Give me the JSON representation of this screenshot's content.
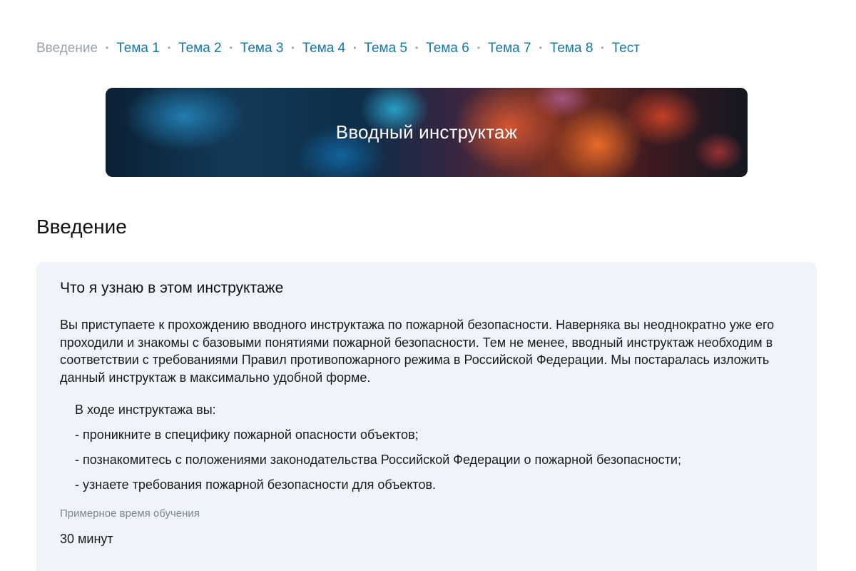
{
  "breadcrumbs": {
    "items": [
      {
        "label": "Введение",
        "current": true
      },
      {
        "label": "Тема 1",
        "current": false
      },
      {
        "label": "Тема 2",
        "current": false
      },
      {
        "label": "Тема 3",
        "current": false
      },
      {
        "label": "Тема 4",
        "current": false
      },
      {
        "label": "Тема 5",
        "current": false
      },
      {
        "label": "Тема 6",
        "current": false
      },
      {
        "label": "Тема 7",
        "current": false
      },
      {
        "label": "Тема 8",
        "current": false
      },
      {
        "label": "Тест",
        "current": false
      }
    ],
    "separator": "•"
  },
  "banner": {
    "title": "Вводный инструктаж"
  },
  "section": {
    "title": "Введение"
  },
  "card": {
    "title": "Что я узнаю в этом инструктаже",
    "intro": "Вы приступаете к прохождению вводного инструктажа по пожарной безопасности. Наверняка вы неоднократно уже его проходили и знакомы с базовыми понятиями пожарной безопасности. Тем не менее, вводный инструктаж необходим в соответствии с требованиями Правил противопожарного режима в Российской Федерации. Мы постаралась изложить данный инструктаж в максимально удобной форме.",
    "learn_heading": "В ходе инструктажа вы:",
    "learn_items": [
      "- проникните в специфику пожарной опасности объектов;",
      "- познакомитесь с положениями законодательства Российской Федерации о пожарной безопасности;",
      "- узнаете требования пожарной безопасности для объектов."
    ],
    "time_label": "Примерное время обучения",
    "time_value": "30 минут"
  },
  "colors": {
    "link": "#1478a8",
    "muted": "#9aa3ad",
    "card_bg": "#eef4fa"
  }
}
